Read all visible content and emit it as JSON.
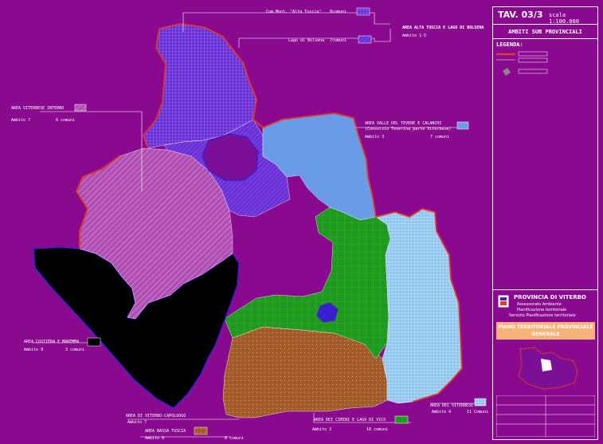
{
  "title_block": {
    "tav": "TAV. 03/3",
    "scale": "scala 1:100.000",
    "ambiti": "AMBITI SUB PROVINCIALI",
    "legenda": "LEGENDA:"
  },
  "provincia": {
    "name": "PROVINCIA DI VITERBO",
    "line1": "Assessorato Ambiente",
    "line2": "Pianificazione territoriale",
    "line3": "Servizio Pianificazione territoriale",
    "plan": "PIANO TERRITORIALE PROVINCIALE GENERALE"
  },
  "areas": [
    {
      "name": "AREA ALTA TUSCIA E LAGO DI BOLSENA",
      "ambito": "Ambito 1-5",
      "sub1": "Com.Mont. \"Alta Tuscia\"",
      "sub1_count": "8comuni",
      "sub2": "Lago di Bolsena",
      "sub2_count": "7comuni",
      "color": "#6a2fd6"
    },
    {
      "name": "AREA VITERBESE INTERNO",
      "ambito": "Ambito 7",
      "count": "6 comuni",
      "color": "#c060c0"
    },
    {
      "name": "AREA VALLE DEL TEVERE E CALANCHI",
      "sub": "(Consorzio Teverina_parte Viterbese)",
      "ambito": "Ambito 3",
      "count": "7 comuni",
      "color": "#6a9be6"
    },
    {
      "name": "AREA COSTIERA E MAREMMA",
      "ambito": "Ambito 9",
      "count": "3 comuni",
      "color": "#000000"
    },
    {
      "name": "AREA DI VITERBO-CAPOLUOGO",
      "ambito": "Ambito 7",
      "color": "#4a1fb0"
    },
    {
      "name": "AREA BASSA TUSCIA",
      "ambito": "Ambito 6",
      "count": "8 comuni",
      "color": "#a15a2a"
    },
    {
      "name": "AREA DEI CIMINI E LAGO DI VICO",
      "ambito": "Ambito 2",
      "count": "18 comuni",
      "color": "#1f9a1f"
    },
    {
      "name": "AREA DEL VITERBESE",
      "ambito": "Ambito 4",
      "count": "11 Comuni",
      "color": "#8fc6f0"
    }
  ],
  "colors": {
    "background": "#8a0a8f",
    "boundary": "#e03a2a",
    "lake": "#3a1fcf"
  }
}
